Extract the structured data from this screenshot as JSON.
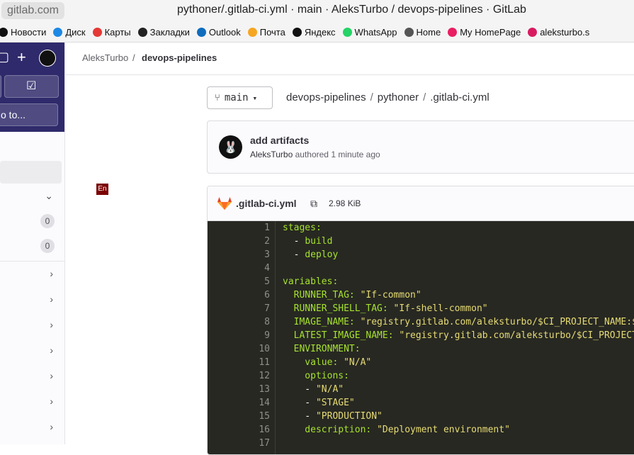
{
  "browser": {
    "url_host": "gitlab.com",
    "title": "pythoner/.gitlab-ci.yml · main · AleksTurbo / devops-pipelines · GitLab"
  },
  "bookmarks": [
    {
      "label": "Новости",
      "icon": "news-icon",
      "color": "#111111"
    },
    {
      "label": "Диск",
      "icon": "disk-icon",
      "color": "#1e88e5"
    },
    {
      "label": "Карты",
      "icon": "maps-pin-icon",
      "color": "#e53935"
    },
    {
      "label": "Закладки",
      "icon": "bookmark-icon",
      "color": "#222222"
    },
    {
      "label": "Outlook",
      "icon": "outlook-icon",
      "color": "#0f6cbd"
    },
    {
      "label": "Почта",
      "icon": "mail-icon",
      "color": "#f5a623"
    },
    {
      "label": "Яндекс",
      "icon": "yandex-icon",
      "color": "#111111"
    },
    {
      "label": "WhatsApp",
      "icon": "whatsapp-icon",
      "color": "#25d366"
    },
    {
      "label": "Home",
      "icon": "page-icon",
      "color": "#555555"
    },
    {
      "label": "My HomePage",
      "icon": "homepage-icon",
      "color": "#e91e63"
    },
    {
      "label": "aleksturbo.s",
      "icon": "site-icon",
      "color": "#d81b60"
    }
  ],
  "sidebar": {
    "goto_label": "o to...",
    "badges": [
      "0",
      "0"
    ]
  },
  "breadcrumb": {
    "owner": "AleksTurbo",
    "separator": "/",
    "project": "devops-pipelines"
  },
  "lang_tag": "En",
  "branch": {
    "name": "main"
  },
  "file_path": {
    "root": "devops-pipelines",
    "folder": "pythoner",
    "file": ".gitlab-ci.yml",
    "sep": "/"
  },
  "commit": {
    "title": "add artifacts",
    "author": "AleksTurbo",
    "action": "authored",
    "time": "1 minute ago"
  },
  "file": {
    "name": ".gitlab-ci.yml",
    "size": "2.98 KiB"
  },
  "code_lines": [
    {
      "n": "1",
      "segs": [
        [
          "k",
          "stages:"
        ]
      ]
    },
    {
      "n": "2",
      "segs": [
        [
          "p",
          "  - "
        ],
        [
          "k",
          "build"
        ]
      ]
    },
    {
      "n": "3",
      "segs": [
        [
          "p",
          "  - "
        ],
        [
          "k",
          "deploy"
        ]
      ]
    },
    {
      "n": "4",
      "segs": []
    },
    {
      "n": "5",
      "segs": [
        [
          "k",
          "variables:"
        ]
      ]
    },
    {
      "n": "6",
      "segs": [
        [
          "k",
          "  RUNNER_TAG: "
        ],
        [
          "s",
          "\"If-common\""
        ]
      ]
    },
    {
      "n": "7",
      "segs": [
        [
          "k",
          "  RUNNER_SHELL_TAG: "
        ],
        [
          "s",
          "\"If-shell-common\""
        ]
      ]
    },
    {
      "n": "8",
      "segs": [
        [
          "k",
          "  IMAGE_NAME: "
        ],
        [
          "s",
          "\"registry.gitlab.com/aleksturbo/$CI_PROJECT_NAME:$"
        ]
      ]
    },
    {
      "n": "9",
      "segs": [
        [
          "k",
          "  LATEST_IMAGE_NAME: "
        ],
        [
          "s",
          "\"registry.gitlab.com/aleksturbo/$CI_PROJECT"
        ]
      ]
    },
    {
      "n": "10",
      "segs": [
        [
          "k",
          "  ENVIRONMENT:"
        ]
      ]
    },
    {
      "n": "11",
      "segs": [
        [
          "k",
          "    value: "
        ],
        [
          "s",
          "\"N/A\""
        ]
      ]
    },
    {
      "n": "12",
      "segs": [
        [
          "k",
          "    options:"
        ]
      ]
    },
    {
      "n": "13",
      "segs": [
        [
          "p",
          "    - "
        ],
        [
          "s",
          "\"N/A\""
        ]
      ]
    },
    {
      "n": "14",
      "segs": [
        [
          "p",
          "    - "
        ],
        [
          "s",
          "\"STAGE\""
        ]
      ]
    },
    {
      "n": "15",
      "segs": [
        [
          "p",
          "    - "
        ],
        [
          "s",
          "\"PRODUCTION\""
        ]
      ]
    },
    {
      "n": "16",
      "segs": [
        [
          "k",
          "    description: "
        ],
        [
          "s",
          "\"Deployment environment\""
        ]
      ]
    },
    {
      "n": "17",
      "segs": []
    }
  ]
}
